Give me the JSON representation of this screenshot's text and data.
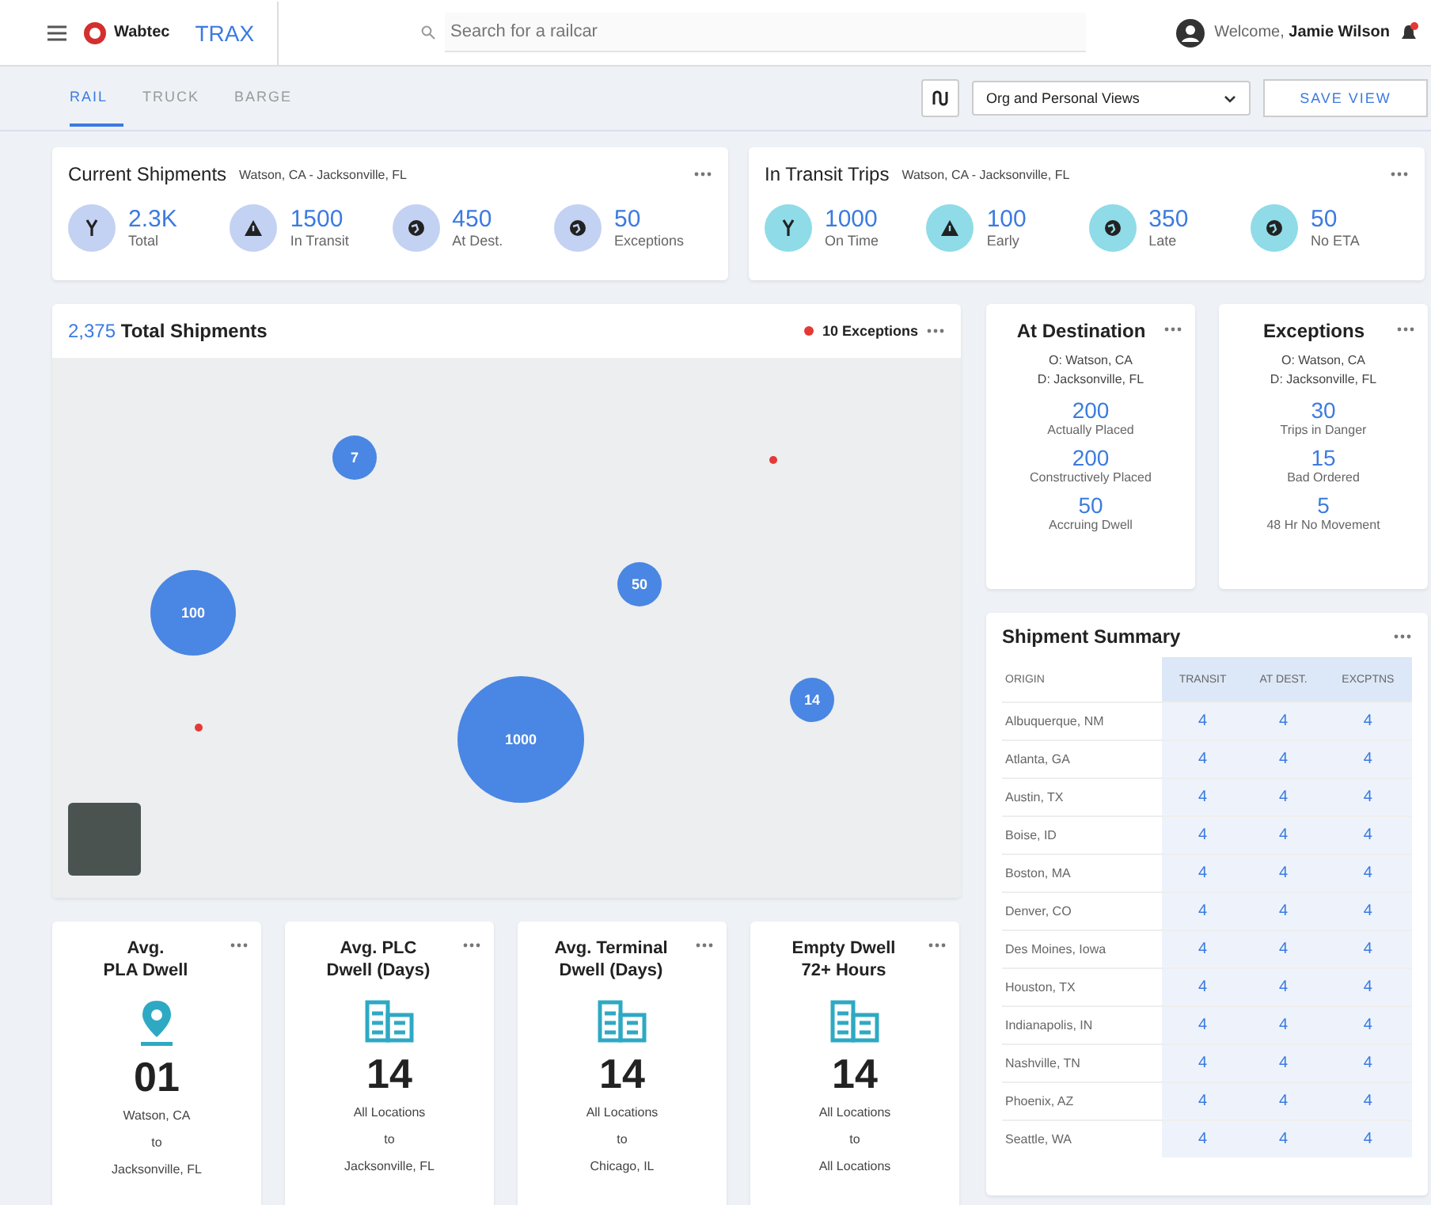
{
  "header": {
    "brand": "Wabtec",
    "app_name": "TRAX",
    "search": {
      "placeholder": "Search for a railcar"
    },
    "welcome": "Welcome,",
    "user": "Jamie Wilson"
  },
  "mode_tabs": [
    {
      "label": "RAIL",
      "selected": true
    },
    {
      "label": "TRUCK",
      "selected": false
    },
    {
      "label": "BARGE",
      "selected": false
    }
  ],
  "view_select": {
    "value": "Org and Personal Views"
  },
  "save_button": "SAVE VIEW",
  "summary_cards": [
    {
      "title": "Current Shipments",
      "subtitle": "Watson, CA - Jacksonville, FL",
      "color": "#c3d2f2",
      "stats": [
        {
          "kind": "fork",
          "value": "2.3K",
          "label": "Total"
        },
        {
          "kind": "alert",
          "value": "1500",
          "label": "In Transit"
        },
        {
          "kind": "globe",
          "value": "450",
          "label": "At Dest."
        },
        {
          "kind": "globe",
          "value": "50",
          "label": "Exceptions"
        }
      ]
    },
    {
      "title": "In Transit Trips",
      "subtitle": "Watson, CA - Jacksonville, FL",
      "color": "#8fdbe8",
      "stats": [
        {
          "kind": "fork",
          "value": "1000",
          "label": "On Time"
        },
        {
          "kind": "alert",
          "value": "100",
          "label": "Early"
        },
        {
          "kind": "globe",
          "value": "350",
          "label": "Late"
        },
        {
          "kind": "globe",
          "value": "50",
          "label": "No ETA"
        }
      ]
    }
  ],
  "map": {
    "total": "2,375",
    "title": "Total Shipments",
    "exceptions_count": "10",
    "exceptions_label": "Exceptions",
    "clusters": [
      {
        "label": "7"
      },
      {
        "label": "100"
      },
      {
        "label": "1000"
      },
      {
        "label": "50"
      },
      {
        "label": "14"
      }
    ]
  },
  "side_cards": [
    {
      "title": "At Destination",
      "origin": "O: Watson, CA",
      "destination": "D: Jacksonville, FL",
      "metrics": [
        {
          "value": "200",
          "label": "Actually Placed"
        },
        {
          "value": "200",
          "label": "Constructively Placed"
        },
        {
          "value": "50",
          "label": "Accruing Dwell"
        }
      ]
    },
    {
      "title": "Exceptions",
      "origin": "O: Watson, CA",
      "destination": "D: Jacksonville, FL",
      "metrics": [
        {
          "value": "30",
          "label": "Trips in Danger"
        },
        {
          "value": "15",
          "label": "Bad Ordered"
        },
        {
          "value": "5",
          "label": "48 Hr No Movement"
        }
      ]
    }
  ],
  "shipment_summary": {
    "title": "Shipment Summary",
    "columns": [
      "ORIGIN",
      "TRANSIT",
      "AT DEST.",
      "EXCPTNS"
    ],
    "rows": [
      {
        "origin": "Albuquerque, NM",
        "values": [
          "4",
          "4",
          "4"
        ]
      },
      {
        "origin": "Atlanta, GA",
        "values": [
          "4",
          "4",
          "4"
        ]
      },
      {
        "origin": "Austin, TX",
        "values": [
          "4",
          "4",
          "4"
        ]
      },
      {
        "origin": "Boise, ID",
        "values": [
          "4",
          "4",
          "4"
        ]
      },
      {
        "origin": "Boston, MA",
        "values": [
          "4",
          "4",
          "4"
        ]
      },
      {
        "origin": "Denver, CO",
        "values": [
          "4",
          "4",
          "4"
        ]
      },
      {
        "origin": "Des Moines, Iowa",
        "values": [
          "4",
          "4",
          "4"
        ]
      },
      {
        "origin": "Houston, TX",
        "values": [
          "4",
          "4",
          "4"
        ]
      },
      {
        "origin": "Indianapolis, IN",
        "values": [
          "4",
          "4",
          "4"
        ]
      },
      {
        "origin": "Nashville, TN",
        "values": [
          "4",
          "4",
          "4"
        ]
      },
      {
        "origin": "Phoenix, AZ",
        "values": [
          "4",
          "4",
          "4"
        ]
      },
      {
        "origin": "Seattle, WA",
        "values": [
          "4",
          "4",
          "4"
        ]
      }
    ]
  },
  "dwell_cards": [
    {
      "title_lines": [
        "Avg.",
        "PLA Dwell"
      ],
      "kind": "pin",
      "value": "01",
      "from": "Watson, CA",
      "joiner": "to",
      "to": "Jacksonville, FL"
    },
    {
      "title_lines": [
        "Avg. PLC",
        "Dwell (Days)"
      ],
      "kind": "building",
      "value": "14",
      "from": "All Locations",
      "joiner": "to",
      "to": "Jacksonville, FL"
    },
    {
      "title_lines": [
        "Avg. Terminal",
        "Dwell (Days)"
      ],
      "kind": "building",
      "value": "14",
      "from": "All Locations",
      "joiner": "to",
      "to": "Chicago, IL"
    },
    {
      "title_lines": [
        "Empty Dwell",
        "72+ Hours"
      ],
      "kind": "building",
      "value": "14",
      "from": "All Locations",
      "joiner": "to",
      "to": "All Locations"
    }
  ]
}
